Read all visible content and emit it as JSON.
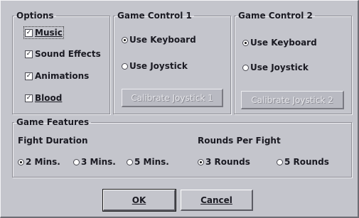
{
  "options": {
    "title": "Options",
    "items": [
      {
        "label": "Music",
        "checked": true
      },
      {
        "label": "Sound Effects",
        "checked": true
      },
      {
        "label": "Animations",
        "checked": true
      },
      {
        "label": "Blood",
        "checked": true
      }
    ]
  },
  "game_control_1": {
    "title": "Game Control 1",
    "keyboard_label": "Use Keyboard",
    "joystick_label": "Use Joystick",
    "selected": "keyboard",
    "calibrate_label": "Calibrate Joystick 1"
  },
  "game_control_2": {
    "title": "Game Control 2",
    "keyboard_label": "Use Keyboard",
    "joystick_label": "Use Joystick",
    "selected": "keyboard",
    "calibrate_label": "Calibrate Joystick 2"
  },
  "game_features": {
    "title": "Game Features",
    "fight_duration": {
      "label": "Fight Duration",
      "options": [
        "2 Mins.",
        "3 Mins.",
        "5 Mins."
      ],
      "selected": "2 Mins."
    },
    "rounds_per_fight": {
      "label": "Rounds Per Fight",
      "options": [
        "3 Rounds",
        "5 Rounds"
      ],
      "selected": "3 Rounds"
    }
  },
  "buttons": {
    "ok_label": "OK",
    "cancel_label": "Cancel"
  }
}
